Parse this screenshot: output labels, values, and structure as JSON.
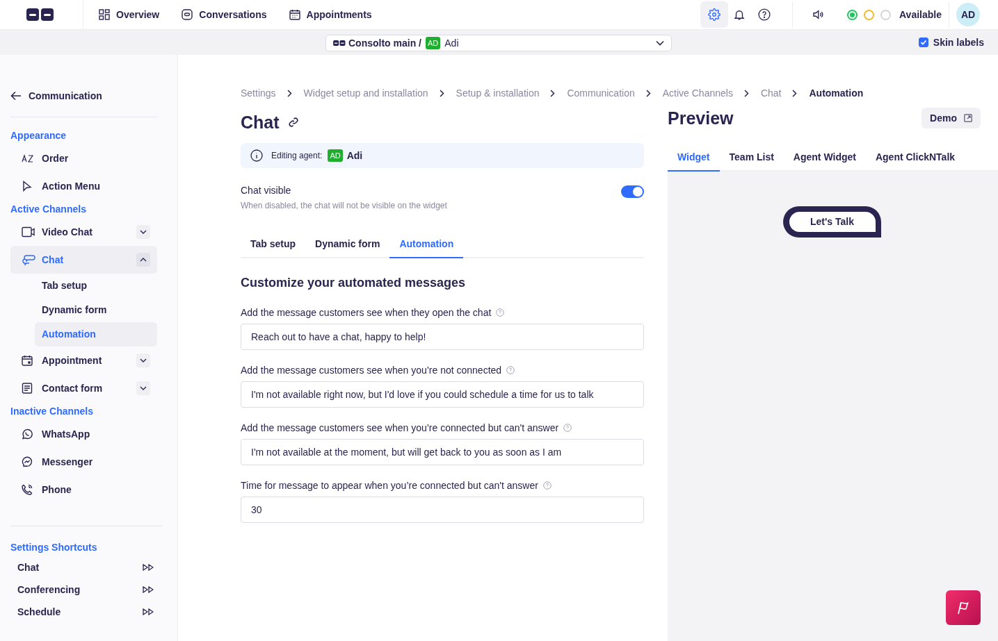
{
  "topbar": {
    "nav": [
      {
        "label": "Overview"
      },
      {
        "label": "Conversations"
      },
      {
        "label": "Appointments"
      }
    ],
    "tools": [
      {
        "selected": true
      },
      {
        "selected": false
      },
      {
        "selected": false
      }
    ],
    "status_dots": [
      {
        "color": "#22c55e",
        "selected": true
      },
      {
        "color": "#f5b82e",
        "selected": false
      },
      {
        "color": "#d4d4dc",
        "selected": false
      }
    ],
    "status": "Available",
    "avatar": "AD"
  },
  "subbar": {
    "account": "Consolto main /",
    "agent_badge": "AD",
    "agent": "Adi",
    "skin_labels": {
      "label": "Skin labels",
      "checked": true
    }
  },
  "sidebar": {
    "back": "Communication",
    "sections": [
      {
        "title": "Appearance",
        "items": [
          {
            "label": "Order",
            "selected": false
          },
          {
            "label": "Action Menu",
            "selected": false
          }
        ]
      },
      {
        "title": "Active Channels",
        "items": [
          {
            "label": "Video Chat",
            "selected": false,
            "expanded": false
          },
          {
            "label": "Chat",
            "selected": true,
            "expanded": true,
            "children": [
              {
                "label": "Tab setup",
                "selected": false
              },
              {
                "label": "Dynamic form",
                "selected": false
              },
              {
                "label": "Automation",
                "selected": true
              }
            ]
          },
          {
            "label": "Appointment",
            "selected": false,
            "expanded": false
          },
          {
            "label": "Contact form",
            "selected": false,
            "expanded": false
          }
        ]
      },
      {
        "title": "Inactive Channels",
        "items": [
          {
            "label": "WhatsApp",
            "selected": false
          },
          {
            "label": "Messenger",
            "selected": false
          },
          {
            "label": "Phone",
            "selected": false
          }
        ]
      }
    ],
    "shortcuts": {
      "title": "Settings Shortcuts",
      "items": [
        {
          "label": "Chat"
        },
        {
          "label": "Conferencing"
        },
        {
          "label": "Schedule"
        }
      ]
    }
  },
  "breadcrumbs": [
    "Settings",
    "Widget setup and installation",
    "Setup & installation",
    "Communication",
    "Active Channels",
    "Chat",
    "Automation"
  ],
  "page": {
    "title": "Chat",
    "editing_label": "Editing agent:",
    "editing_badge": "AD",
    "editing_agent": "Adi",
    "visible": {
      "label": "Chat visible",
      "description": "When disabled, the chat will not be visible on the widget",
      "on": true
    },
    "tabs": [
      {
        "label": "Tab setup",
        "selected": false
      },
      {
        "label": "Dynamic form",
        "selected": false
      },
      {
        "label": "Automation",
        "selected": true
      }
    ],
    "heading": "Customize your automated messages",
    "fields": [
      {
        "label": "Add the message customers see when they open the chat",
        "value": "Reach out to have a chat, happy to help!"
      },
      {
        "label": "Add the message customers see when you’re not connected",
        "value": "I'm not available right now, but I'd love if you could schedule a time for us to talk"
      },
      {
        "label": "Add the message customers see when you’re connected but can't answer",
        "value": "I'm not available at the moment, but will get back to you as soon as I am"
      },
      {
        "label": "Time for message to appear when you’re connected but can't answer",
        "value": "30"
      }
    ]
  },
  "preview": {
    "title": "Preview",
    "demo": "Demo",
    "tabs": [
      {
        "label": "Widget",
        "selected": true
      },
      {
        "label": "Team List",
        "selected": false
      },
      {
        "label": "Agent Widget",
        "selected": false
      },
      {
        "label": "Agent ClickNTalk",
        "selected": false
      }
    ],
    "widget_button": "Let's Talk"
  }
}
